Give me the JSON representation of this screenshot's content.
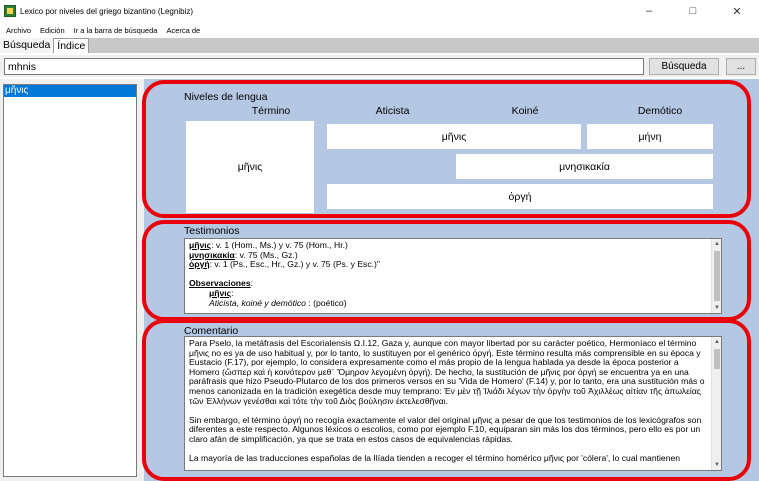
{
  "window": {
    "title": "Lexico por niveles del griego bizantino (Legnibiz)",
    "controls": {
      "minimize": "–",
      "maximize": "□",
      "close": "✕"
    }
  },
  "menu": [
    "Archivo",
    "Edición",
    "Ir a la barra de búsqueda",
    "Acerca de"
  ],
  "tabs": [
    {
      "label": "Búsqueda",
      "active": false
    },
    {
      "label": "Índice",
      "active": true
    }
  ],
  "search": {
    "value": "mhnis",
    "button_label": "Búsqueda",
    "more_label": "..."
  },
  "results": [
    "μῆνις"
  ],
  "niveles": {
    "title": "Niveles de lengua",
    "headers": {
      "termino": "Término",
      "aticista": "Aticista",
      "koine": "Koiné",
      "demotico": "Demótico"
    },
    "term": "μῆνις",
    "cells": {
      "menis": "μῆνις",
      "mene": "μήνη",
      "mnesikakia": "μνησικακία",
      "orge": "ὀργή"
    }
  },
  "testimonios": {
    "title": "Testimonios",
    "lines": [
      {
        "term": "μῆνις",
        "text": ": v. 1 (Hom., Ms.) y v. 75 (Hom., Hr.)"
      },
      {
        "term": "μνησικακία",
        "text": ": v. 75 (Ms., Gz.)"
      },
      {
        "term": "ὀργή",
        "text": ": v. 1 (Ps., Esc., Hr., Gz.) y v. 75 (Ps. y Esc.)\""
      }
    ],
    "obs_title": "Observaciones",
    "obs_term": "μῆνις",
    "obs_levels": "Aticista, koiné y demótico",
    "obs_note": " : (poético)"
  },
  "comentario": {
    "title": "Comentario",
    "paragraphs": [
      "Para Pselo, la metáfrasis del Escorialensis Ω.I.12, Gaza y, aunque con mayor libertad por su carácter poético, Hermoníaco el término μῆνις no es ya de uso habitual y, por lo tanto, lo sustituyen por el genérico ὀργή.  Este término resulta más comprensible en su época y Eustacio (F.17), por ejemplo, lo considera expresamente como el más propio de la lengua hablada ya desde la época posterior a Homero (ὥσπερ καὶ ἡ κοινότερον μεθ᾽ Ὅμηρον λεγομένη ὀργή). De hecho, la sustitución de μῆνις por ὀργή se encuentra ya en una paráfrasis que hizo Pseudo-Plutarco de los dos primeros versos en su 'Vida de Homero' (F.14) y, por lo tanto, era una sustitución más o menos canonizada en la tradición exegética desde muy temprano: Ἐν μὲν τῇ Ἰλιάδι λέγων τὴν ὀργὴν τοῦ Ἀχιλλέως αἰτίαν τῆς ἀπωλείας τῶν Ἑλλήνων γενέσθαι καὶ τότε τὴν τοῦ Διὸς βούλησιν ἐκτελεσθῆναι.",
      "Sin embargo, el término ὀργή no recogía exactamente el valor del original μῆνις a pesar de que los testimonios de los lexicógrafos son diferentes a este respecto. Algunos léxicos o escolios, como por ejemplo F.10, equiparan sin más los dos términos, pero ello es por un claro afán de simplificación, ya que se trata en estos casos de equivalencias rápidas.",
      "La mayoría de las traducciones españolas de la Ilíada tienden a recoger el término homérico μῆνις por 'cólera',  lo cual mantienen"
    ]
  }
}
